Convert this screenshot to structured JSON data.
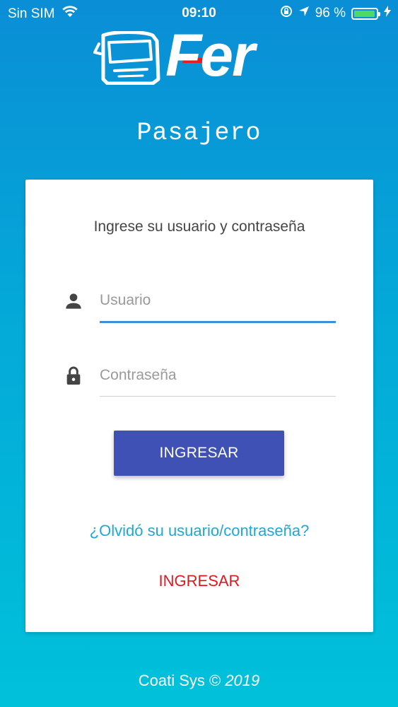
{
  "status_bar": {
    "carrier": "Sin SIM",
    "time": "09:10",
    "battery": "96 %",
    "battery_level": 0.96,
    "icons": [
      "wifi-icon",
      "rotation-lock-icon",
      "location-arrow-icon",
      "battery-icon",
      "charging-bolt-icon"
    ]
  },
  "brand": {
    "logo_text": "Fer",
    "accent_color": "#e51e25"
  },
  "title": "Pasajero",
  "login": {
    "instruction": "Ingrese su usuario y contraseña",
    "username": {
      "placeholder": "Usuario",
      "value": "",
      "icon": "person-icon"
    },
    "password": {
      "placeholder": "Contraseña",
      "value": "",
      "icon": "lock-icon"
    },
    "submit_label": "INGRESAR",
    "forgot_label": "¿Olvidó su usuario/contraseña?",
    "secondary_label": "INGRESAR"
  },
  "footer": {
    "company": "Coati Sys ©",
    "year": "2019"
  },
  "colors": {
    "primary_button": "#3f51b5",
    "link": "#1ea8d5",
    "secondary_link": "#e5171e",
    "active_underline": "#3d8fdc",
    "background_top": "#0a8ed6",
    "background_bottom": "#00c1da"
  }
}
